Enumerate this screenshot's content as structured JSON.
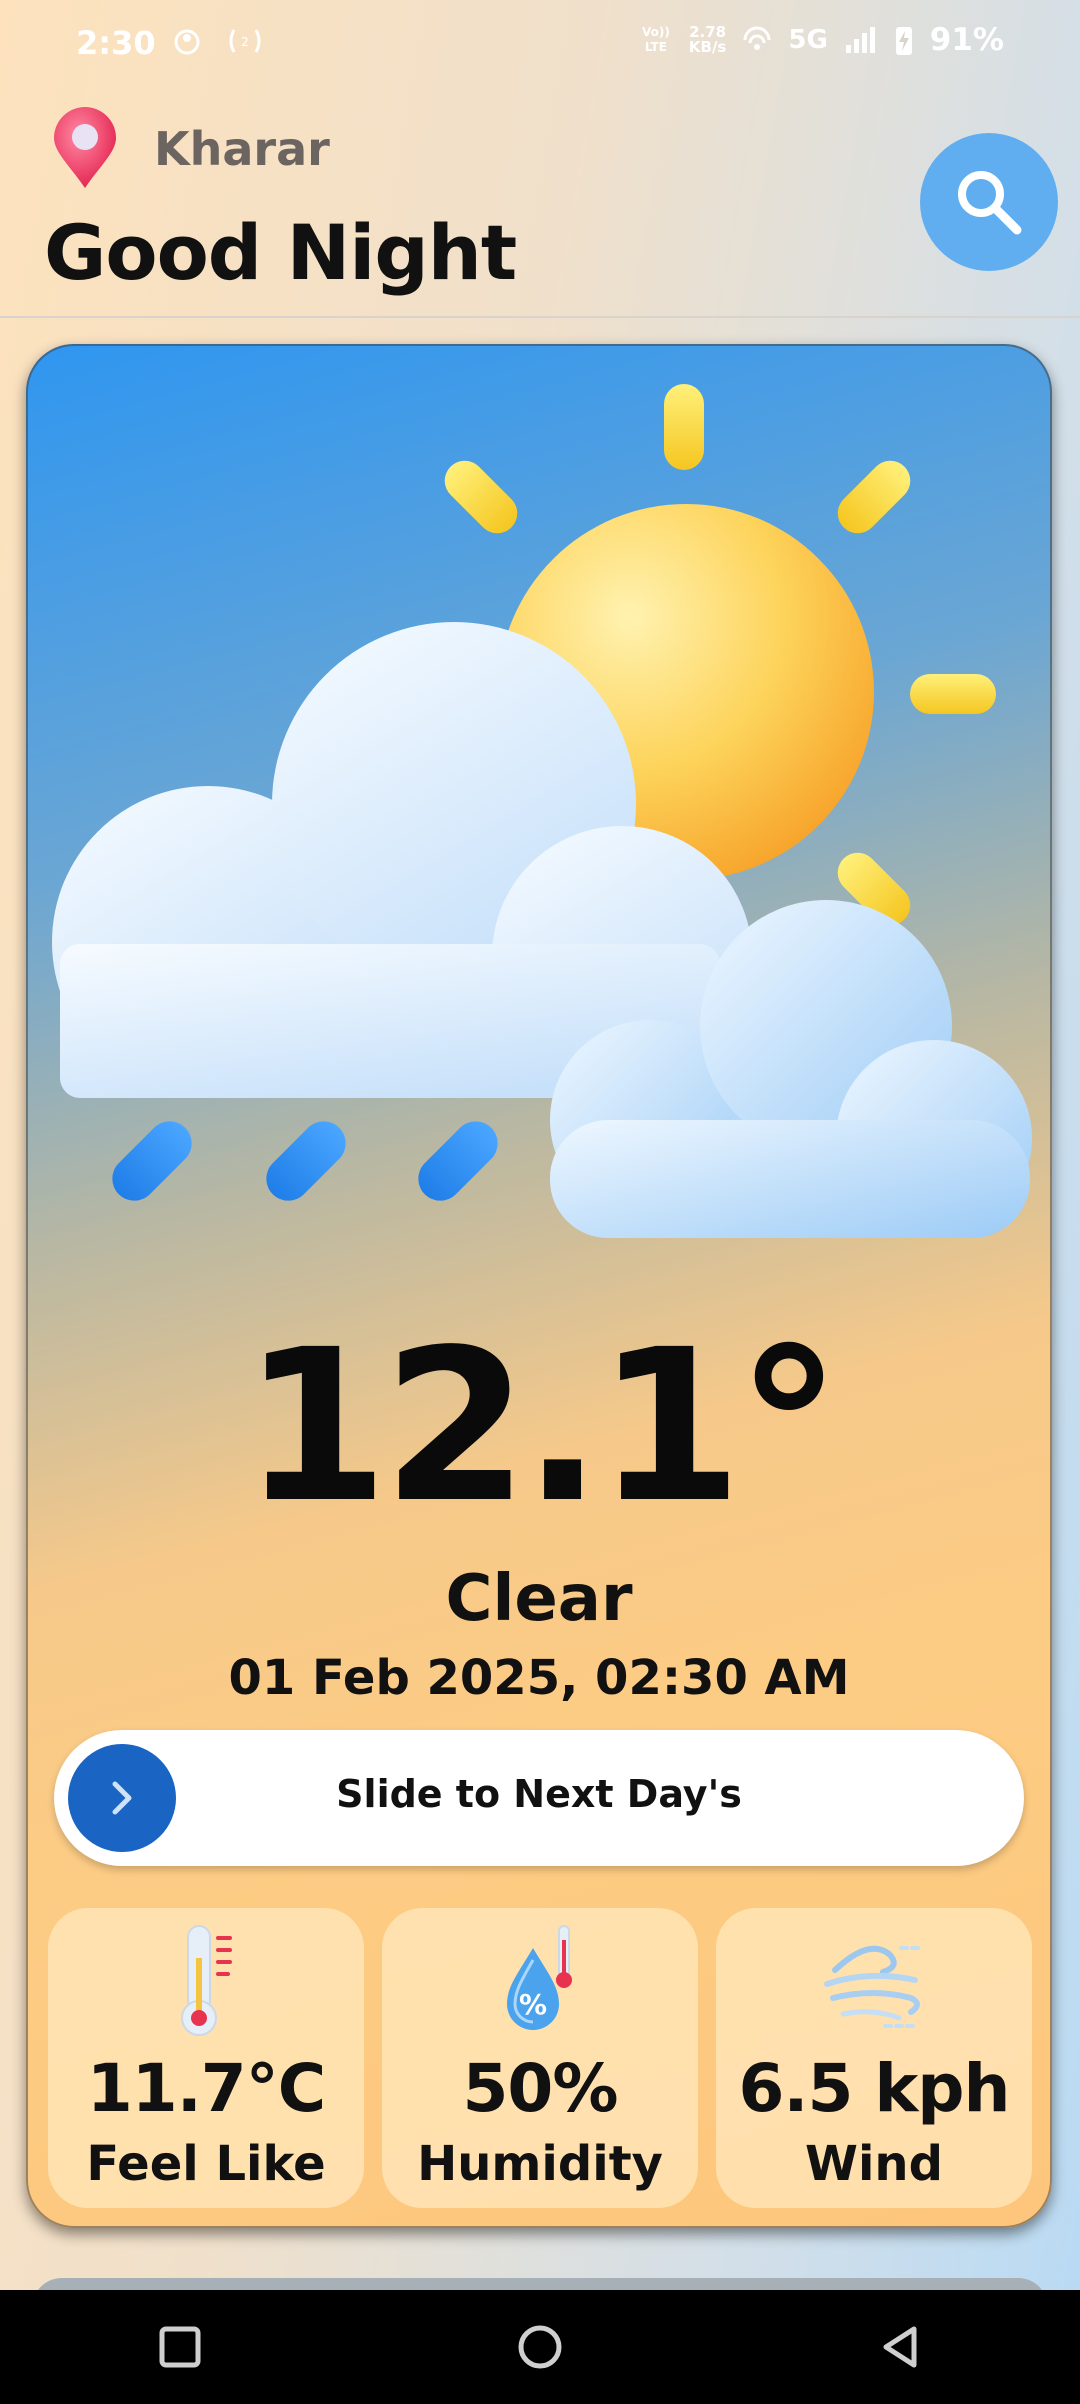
{
  "status_bar": {
    "time": "2:30",
    "volte_label": "Vo)) LTE",
    "net_speed_value": "2.78",
    "net_speed_unit": "KB/s",
    "network_type": "5G",
    "battery": "91%"
  },
  "header": {
    "location": "Kharar",
    "greeting": "Good Night"
  },
  "weather": {
    "temperature": "12.1°",
    "condition": "Clear",
    "datetime": "01 Feb 2025, 02:30 AM",
    "slider_label": "Slide to Next Day's"
  },
  "stats": [
    {
      "value": "11.7°C",
      "label": "Feel Like",
      "icon": "thermometer-icon"
    },
    {
      "value": "50%",
      "label": "Humidity",
      "icon": "humidity-drop-icon"
    },
    {
      "value": "6.5 kph",
      "label": "Wind",
      "icon": "wind-icon"
    }
  ],
  "colors": {
    "search_button": "#60aef0",
    "slider_knob": "#1a64c4",
    "pin": "#f0456a"
  }
}
